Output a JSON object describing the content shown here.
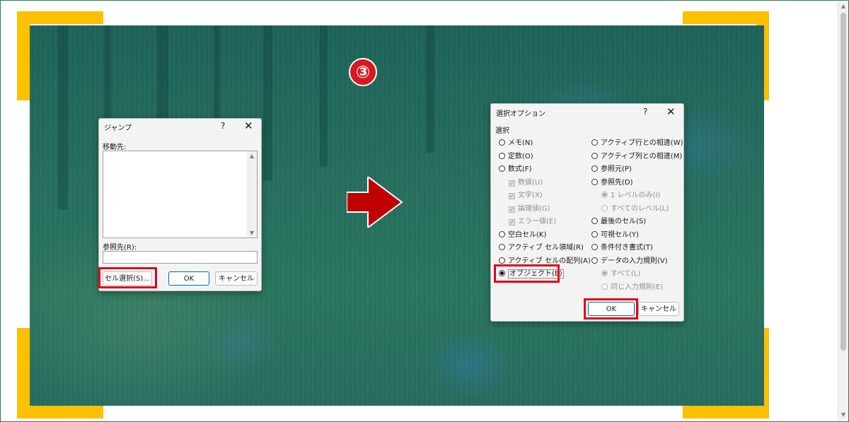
{
  "step_badge": "③",
  "jump_dialog": {
    "title": "ジャンプ",
    "help": "?",
    "close": "✕",
    "goto_label": "移動先:",
    "reference_label": "参照先(R):",
    "reference_value": "",
    "special_button": "セル選択(S)...",
    "ok_button": "OK",
    "cancel_button": "キャンセル"
  },
  "select_dialog": {
    "title": "選択オプション",
    "help": "?",
    "close": "✕",
    "group_label": "選択",
    "left_options": [
      {
        "label": "メモ(N)",
        "kind": "radio",
        "checked": false,
        "disabled": false
      },
      {
        "label": "定数(O)",
        "kind": "radio",
        "checked": false,
        "disabled": false
      },
      {
        "label": "数式(F)",
        "kind": "radio",
        "checked": false,
        "disabled": false
      },
      {
        "label": "数値(U)",
        "kind": "checkbox",
        "checked": true,
        "disabled": true
      },
      {
        "label": "文字(X)",
        "kind": "checkbox",
        "checked": true,
        "disabled": true
      },
      {
        "label": "論理値(G)",
        "kind": "checkbox",
        "checked": true,
        "disabled": true
      },
      {
        "label": "エラー値(E)",
        "kind": "checkbox",
        "checked": true,
        "disabled": true
      },
      {
        "label": "空白セル(K)",
        "kind": "radio",
        "checked": false,
        "disabled": false
      },
      {
        "label": "アクティブ セル領域(R)",
        "kind": "radio",
        "checked": false,
        "disabled": false
      },
      {
        "label": "アクティブ セルの配列(A)",
        "kind": "radio",
        "checked": false,
        "disabled": false
      },
      {
        "label": "オブジェクト(B)",
        "kind": "radio",
        "checked": true,
        "disabled": false
      }
    ],
    "right_options": [
      {
        "label": "アクティブ行との相違(W)",
        "kind": "radio",
        "checked": false,
        "disabled": false
      },
      {
        "label": "アクティブ列との相違(M)",
        "kind": "radio",
        "checked": false,
        "disabled": false
      },
      {
        "label": "参照元(P)",
        "kind": "radio",
        "checked": false,
        "disabled": false
      },
      {
        "label": "参照先(D)",
        "kind": "radio",
        "checked": false,
        "disabled": false
      },
      {
        "label": "1 レベルのみ(I)",
        "kind": "radio",
        "checked": true,
        "disabled": true
      },
      {
        "label": "すべてのレベル(L)",
        "kind": "radio",
        "checked": false,
        "disabled": true
      },
      {
        "label": "最後のセル(S)",
        "kind": "radio",
        "checked": false,
        "disabled": false
      },
      {
        "label": "可視セル(Y)",
        "kind": "radio",
        "checked": false,
        "disabled": false
      },
      {
        "label": "条件付き書式(T)",
        "kind": "radio",
        "checked": false,
        "disabled": false
      },
      {
        "label": "データの入力規則(V)",
        "kind": "radio",
        "checked": false,
        "disabled": false
      },
      {
        "label": "すべて(L)",
        "kind": "radio",
        "checked": true,
        "disabled": true
      },
      {
        "label": "同じ入力規則(E)",
        "kind": "radio",
        "checked": false,
        "disabled": true
      }
    ],
    "ok_button": "OK",
    "cancel_button": "キャンセル"
  },
  "colors": {
    "highlight": "#e0001b",
    "corner_marks": "#ffc000",
    "arrow": "#c00000",
    "badge": "#d71920",
    "overlay": "#1e6e6e"
  }
}
